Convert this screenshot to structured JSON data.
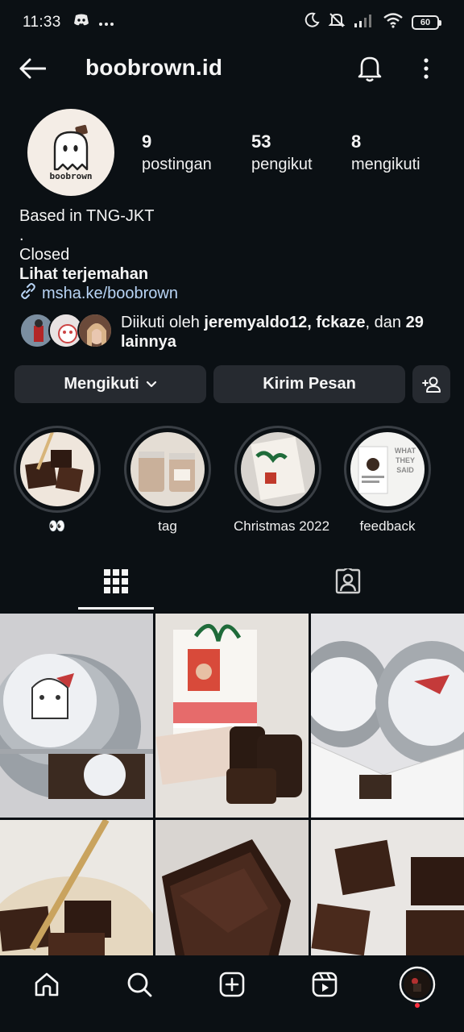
{
  "status_bar": {
    "time": "11:33",
    "battery": "60"
  },
  "header": {
    "username": "boobrown.id"
  },
  "profile": {
    "avatar_logo_text": "boobrown",
    "stats": [
      {
        "value": "9",
        "label": "postingan"
      },
      {
        "value": "53",
        "label": "pengikut"
      },
      {
        "value": "8",
        "label": "mengikuti"
      }
    ],
    "bio": {
      "line1": "Based in TNG-JKT",
      "line2": ".",
      "line3": "Closed",
      "translate": "Lihat terjemahan",
      "link": "msha.ke/boobrown"
    },
    "followed_by": {
      "prefix": "Diikuti oleh ",
      "user1": "jeremyaldo12",
      "sep": ", ",
      "user2": "fckaze",
      "middle": ", dan ",
      "count": "29",
      "suffix": "lainnya"
    }
  },
  "actions": {
    "follow": "Mengikuti",
    "message": "Kirim Pesan"
  },
  "highlights": [
    {
      "label": "👀"
    },
    {
      "label": "tag"
    },
    {
      "label": "Christmas 2022"
    },
    {
      "label": "feedback"
    }
  ],
  "highlight_feedback_text": [
    "WHAT",
    "THEY",
    "SAID"
  ],
  "colors": {
    "background": "#0b1014",
    "button": "#262a30",
    "link": "#b8d4f5",
    "notification_dot": "#ff3040"
  }
}
